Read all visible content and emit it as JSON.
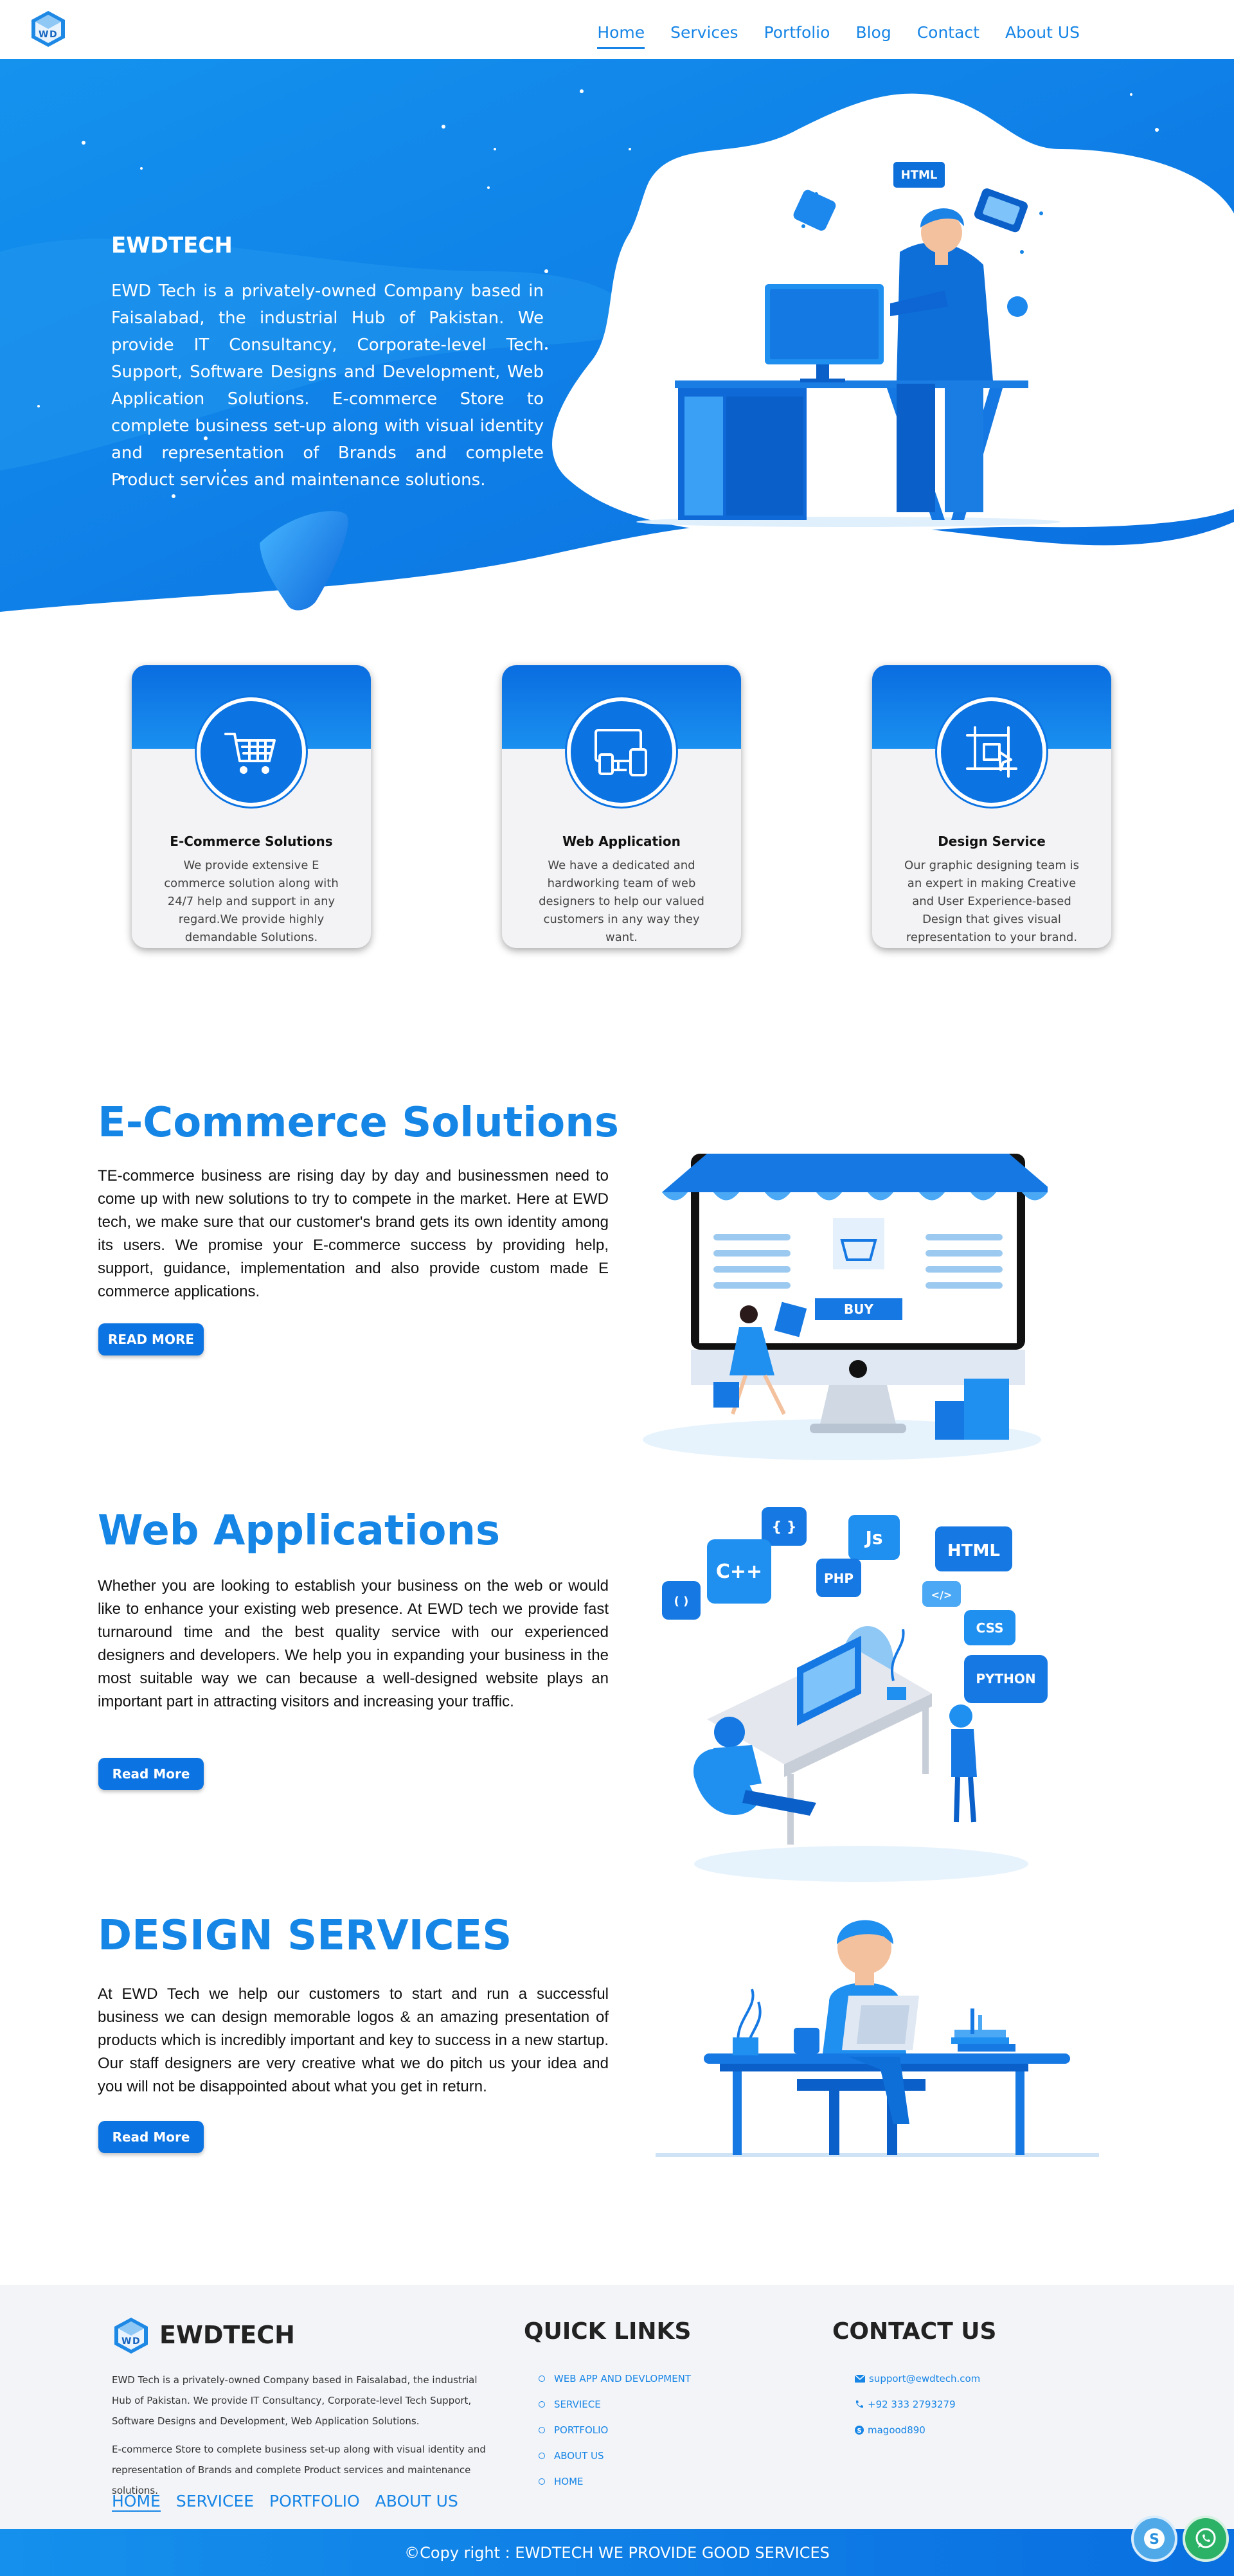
{
  "nav": {
    "logo_icon": "ewd-cube-logo",
    "items": [
      "Home",
      "Services",
      "Portfolio",
      "Blog",
      "Contact",
      "About US"
    ],
    "active": "Home"
  },
  "hero": {
    "title": "EWDTECH",
    "text": "EWD Tech is a privately-owned Company based in Faisalabad, the industrial Hub of Pakistan. We provide IT Consultancy, Corporate-level Tech Support, Software Designs and Development, Web Application Solutions. E-commerce Store to complete business set-up along with visual identity and representation of Brands and complete Product services and maintenance solutions.",
    "illustration": "developer-at-desk-icon",
    "html_badge": "HTML"
  },
  "cards": [
    {
      "icon": "shopping-cart-icon",
      "title": "E-Commerce Solutions",
      "text": "We provide extensive E commerce solution along with 24/7 help and support in any regard.We provide highly demandable Solutions."
    },
    {
      "icon": "devices-icon",
      "title": "Web Application",
      "text": "We have a dedicated and hardworking team of web designers to help our valued customers in any way they want."
    },
    {
      "icon": "design-crop-icon",
      "title": "Design Service",
      "text": "Our graphic designing team is an expert in making Creative and User Experience-based Design that gives visual representation to your brand."
    }
  ],
  "sections": [
    {
      "title": "E-Commerce Solutions",
      "text": "TE-commerce business are rising day by day and businessmen need to come up with new solutions to try to compete in the market. Here at EWD tech, we make sure that our customer's brand gets its own identity among its users. We promise your E-commerce success by providing help, support, guidance, implementation and also provide custom made E commerce applications.",
      "button": "READ MORE",
      "illustration_label": "BUY"
    },
    {
      "title": "Web Applications",
      "text": "Whether you are looking to establish your business on the web or would like to enhance your existing web presence. At EWD tech we provide fast turnaround time and the best quality service with our experienced designers and developers. We help you in expanding your business in the most suitable way we can because a well-designed website plays an important part in attracting visitors and increasing your traffic.",
      "button": "Read More",
      "tags": [
        "{ }",
        "Js",
        "HTML",
        "C++",
        "PHP",
        "</>",
        "CSS",
        "( )",
        "PYTHON"
      ]
    },
    {
      "title": "DESIGN SERVICES",
      "text": "At EWD Tech we help our customers to start and run a successful business we can design memorable logos & an amazing presentation of products which is incredibly important and key to success in a new startup. Our staff designers are very creative what we do pitch us your idea and you will not be disappointed about what you get in return.",
      "button": "Read More"
    }
  ],
  "footer": {
    "brand": "EWDTECH",
    "p1": "EWD Tech is a privately-owned Company based in Faisalabad, the industrial Hub of Pakistan. We provide IT Consultancy, Corporate-level Tech Support, Software Designs and Development, Web Application Solutions.",
    "p2": "E-commerce Store to complete business set-up along with visual identity and representation of Brands and complete Product services and maintenance solutions.",
    "links": [
      "HOME",
      "SERVICEE",
      "PORTFOLIO",
      "ABOUT US"
    ],
    "quick_title": "QUICK LINKS",
    "quick_links": [
      "WEB APP AND DEVLOPMENT",
      "SERVIECE",
      "PORTFOLIO",
      "ABOUT US",
      "HOME"
    ],
    "contact_title": "CONTACT US",
    "contact": [
      {
        "icon": "envelope-icon",
        "text": "support@ewdtech.com"
      },
      {
        "icon": "phone-icon",
        "text": "+92 333 2793279"
      },
      {
        "icon": "skype-icon",
        "text": "magood890"
      }
    ],
    "copyright": "©Copy right : EWDTECH WE PROVIDE GOOD SERVICES"
  },
  "floating": [
    "skype-icon",
    "whatsapp-icon"
  ],
  "colors": {
    "brand": "#1586e5",
    "dark_blue": "#0b73e2",
    "footer_bg": "#f3f4f8"
  }
}
